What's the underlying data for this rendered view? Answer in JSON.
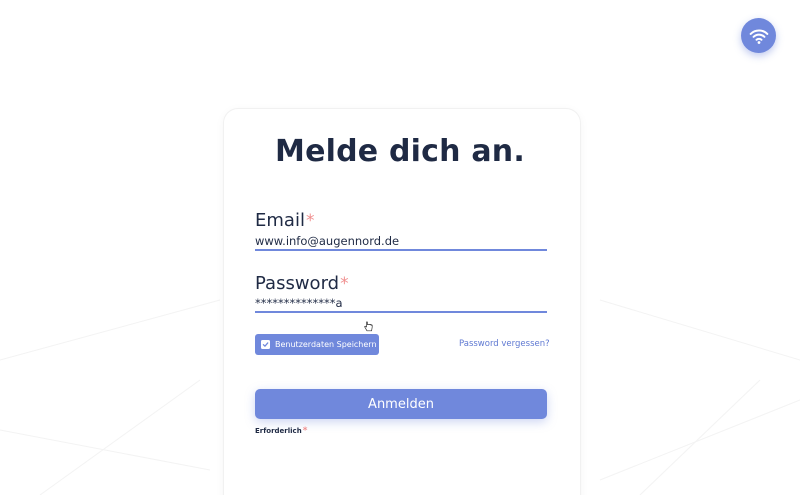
{
  "status": {
    "wifi_icon": "wifi-icon",
    "wifi_color": "#7088dc"
  },
  "login": {
    "title": "Melde dich an.",
    "email": {
      "label": "Email",
      "required_marker": "*",
      "value": "www.info@augennord.de"
    },
    "password": {
      "label": "Password",
      "required_marker": "*",
      "value": "**************a"
    },
    "remember": {
      "label": "Benutzerdaten Speichern",
      "checked": true,
      "icon": "checkmark-icon"
    },
    "forgot_link": "Password vergessen?",
    "submit_label": "Anmelden",
    "required_note": "Erforderlich",
    "required_note_marker": "*"
  },
  "colors": {
    "accent": "#7088dc",
    "text": "#1f2a44",
    "required": "#f08f8f",
    "link": "#5f79d2"
  }
}
